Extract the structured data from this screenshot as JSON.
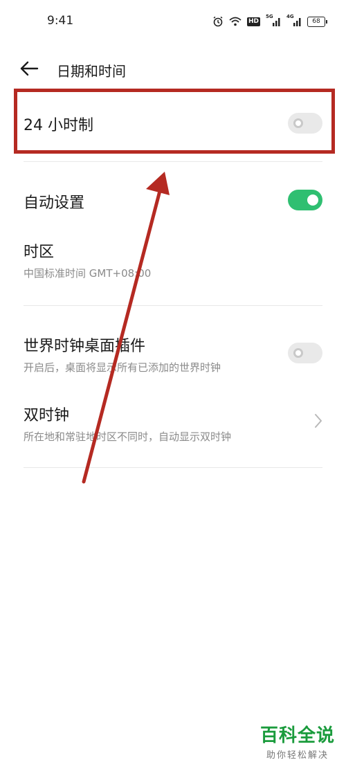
{
  "status_bar": {
    "time": "9:41",
    "hd_label": "HD",
    "net1_label": "5G",
    "net2_label": "4G",
    "battery": "68"
  },
  "header": {
    "title": "日期和时间"
  },
  "settings": {
    "hour24": {
      "label": "24 小时制",
      "enabled": false
    },
    "auto_set": {
      "label": "自动设置",
      "enabled": true
    },
    "timezone": {
      "label": "时区",
      "value": "中国标准时间 GMT+08:00"
    },
    "world_clock_widget": {
      "label": "世界时钟桌面插件",
      "description": "开启后，桌面将显示所有已添加的世界时钟",
      "enabled": false
    },
    "dual_clock": {
      "label": "双时钟",
      "description": "所在地和常驻地时区不同时，自动显示双时钟"
    }
  },
  "colors": {
    "toggle_on": "#2fbf71",
    "toggle_off": "#e9e9e9",
    "annotation": "#b52a22",
    "watermark": "#1a9b3c"
  },
  "watermark": {
    "title": "百科全说",
    "subtitle": "助你轻松解决"
  }
}
